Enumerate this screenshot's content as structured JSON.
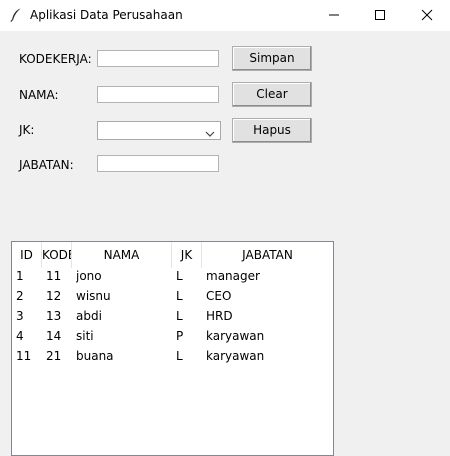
{
  "window": {
    "title": "Aplikasi Data Perusahaan"
  },
  "form": {
    "kodekerja_label": "KODEKERJA:",
    "kodekerja_value": "",
    "nama_label": "NAMA:",
    "nama_value": "",
    "jk_label": "JK:",
    "jk_value": "",
    "jabatan_label": "JABATAN:",
    "jabatan_value": ""
  },
  "buttons": {
    "simpan": "Simpan",
    "clear": "Clear",
    "hapus": "Hapus"
  },
  "table": {
    "columns": [
      "ID",
      "KODEKERJA",
      "NAMA",
      "JK",
      "JABATAN"
    ],
    "rows": [
      [
        "1",
        "11",
        "jono",
        "L",
        "manager"
      ],
      [
        "2",
        "12",
        "wisnu",
        "L",
        "CEO"
      ],
      [
        "3",
        "13",
        "abdi",
        "L",
        "HRD"
      ],
      [
        "4",
        "14",
        "siti",
        "P",
        "karyawan"
      ],
      [
        "11",
        "21",
        "buana",
        "L",
        "karyawan"
      ]
    ]
  },
  "icons": {
    "app": "feather-icon",
    "minimize": "minimize-icon",
    "maximize": "maximize-icon",
    "close": "close-icon",
    "dropdown": "chevron-down-icon"
  }
}
